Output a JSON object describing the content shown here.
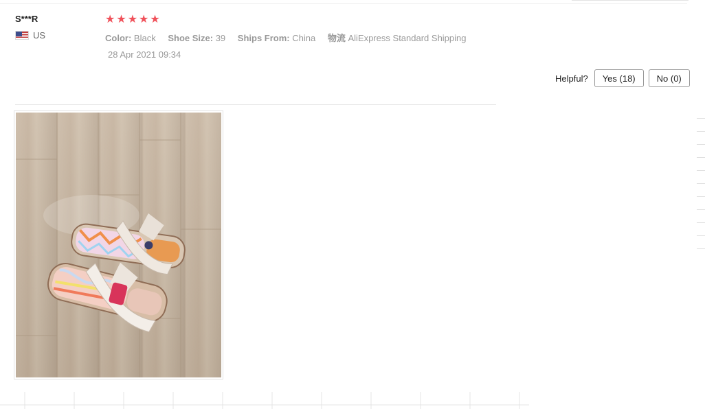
{
  "review": {
    "reviewer_name": "S***R",
    "country_code": "US",
    "rating": 5,
    "stars": [
      "★",
      "★",
      "★",
      "★",
      "★"
    ],
    "color_label": "Color:",
    "color_value": "Black",
    "size_label": "Shoe Size:",
    "size_value": "39",
    "ships_label": "Ships From:",
    "ships_value": "China",
    "logistics_label": "物流",
    "logistics_value": "AliExpress Standard Shipping",
    "date": "28 Apr 2021 09:34"
  },
  "helpful": {
    "label": "Helpful?",
    "yes_label": "Yes (18)",
    "no_label": "No (0)"
  },
  "colors": {
    "star": "#f0515a",
    "text_muted": "#999999",
    "divider": "#e6e6e6"
  },
  "photo": {
    "icon": "review-photo-sandals"
  }
}
